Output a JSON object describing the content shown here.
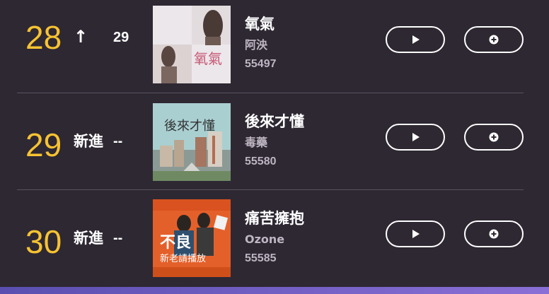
{
  "chart_list": {
    "rows": [
      {
        "rank": "28",
        "trend_icon": "up-arrow-icon",
        "trend": "↑",
        "previous_rank": "29",
        "title": "氧氣",
        "artist": "阿泱",
        "plays": "55497",
        "cover_text": "氧氣",
        "colors": {
          "cover_bg": "#ece7ea"
        }
      },
      {
        "rank": "29",
        "trend": "新進",
        "previous_rank": "--",
        "title": "後來才懂",
        "artist": "毒藥",
        "plays": "55580",
        "cover_text": "後來才懂",
        "colors": {
          "cover_bg": "#9ec6c9"
        }
      },
      {
        "rank": "30",
        "trend": "新進",
        "previous_rank": "--",
        "title": "痛苦擁抱",
        "artist": "Ozone",
        "plays": "55585",
        "cover_text": "不良",
        "cover_subtext": "新老請播放",
        "colors": {
          "cover_bg": "#e4602a"
        }
      }
    ],
    "actions": {
      "play_icon": "play-icon",
      "add_icon": "add-circle-icon"
    }
  },
  "colors": {
    "background": "#2e2833",
    "rank": "#f7c331",
    "secondary_text": "#bdb6c2",
    "divider": "#5a5360"
  }
}
